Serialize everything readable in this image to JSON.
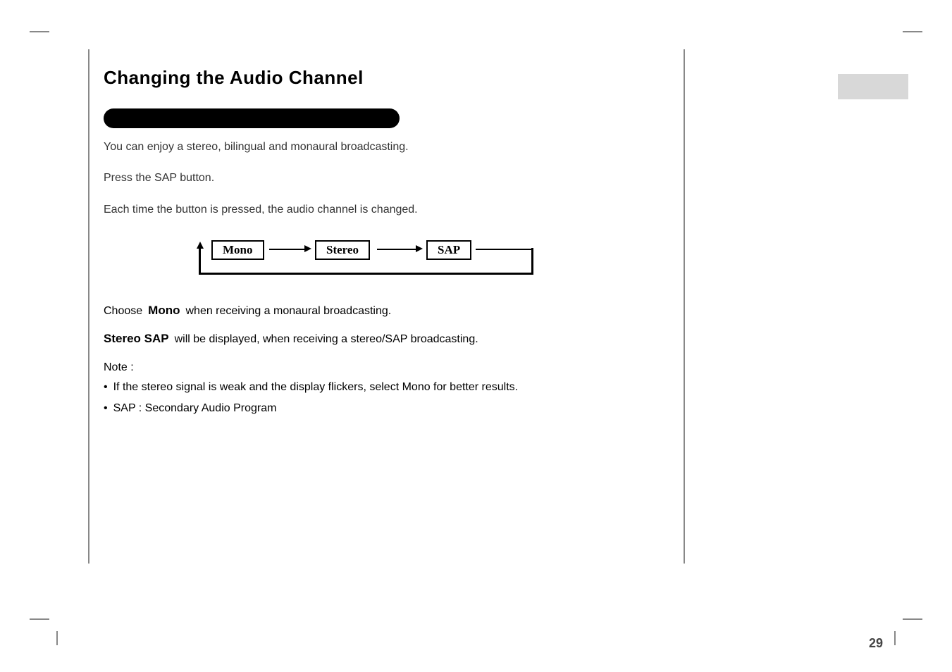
{
  "title": "Changing the Audio Channel",
  "intro": {
    "line1": "You can enjoy a stereo, bilingual and monaural broadcasting.",
    "line2": "Each time the button is pressed, the audio channel is changed."
  },
  "press_instruction": "Press the SAP button.",
  "modes": {
    "mono": "Mono",
    "stereo": "Stereo",
    "sap": "SAP"
  },
  "mono_line": {
    "prefix": "Choose",
    "bold": "Mono",
    "suffix": "when receiving a monaural broadcasting."
  },
  "stereo_sap_line": {
    "bold": "Stereo  SAP",
    "text": "will be displayed, when receiving a stereo/SAP broadcasting."
  },
  "notes": {
    "label": "Note :",
    "items": [
      "If the stereo signal is weak and the display flickers, select Mono for better results.",
      "SAP : Secondary Audio Program"
    ]
  },
  "page_number": "29"
}
